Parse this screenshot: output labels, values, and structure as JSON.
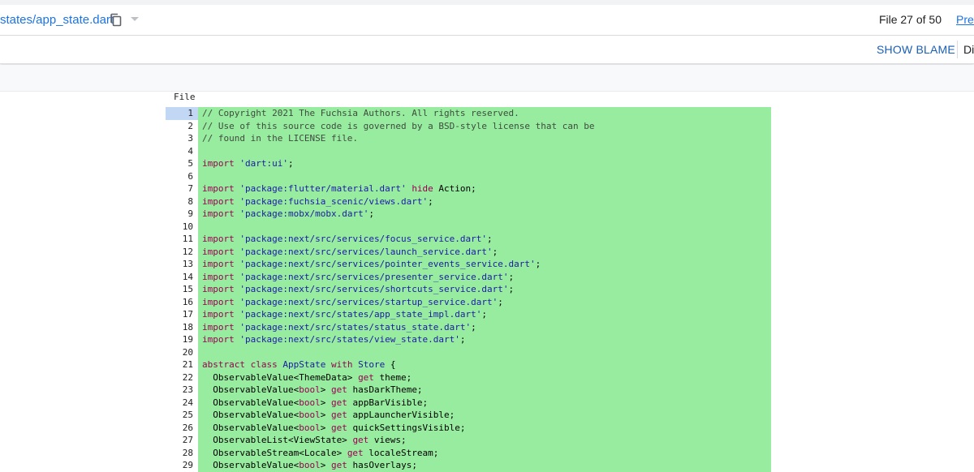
{
  "header": {
    "file_path": "states/app_state.dart",
    "file_count": "File 27 of 50",
    "prev_label": "Prev"
  },
  "toolbar": {
    "blame_label": "SHOW BLAME",
    "diff_label": "Di"
  },
  "file_view": {
    "label": "File",
    "selected_line": 1,
    "highlight_color": "#98ec9f",
    "lines": [
      {
        "n": "1",
        "tokens": [
          [
            "c",
            "// Copyright 2021 The Fuchsia Authors. All rights reserved."
          ]
        ]
      },
      {
        "n": "2",
        "tokens": [
          [
            "c",
            "// Use of this source code is governed by a BSD-style license that can be"
          ]
        ]
      },
      {
        "n": "3",
        "tokens": [
          [
            "c",
            "// found in the LICENSE file."
          ]
        ]
      },
      {
        "n": "4",
        "tokens": []
      },
      {
        "n": "5",
        "tokens": [
          [
            "k",
            "import"
          ],
          [
            "p",
            " "
          ],
          [
            "s",
            "'dart:ui'"
          ],
          [
            "p",
            ";"
          ]
        ]
      },
      {
        "n": "6",
        "tokens": []
      },
      {
        "n": "7",
        "tokens": [
          [
            "k",
            "import"
          ],
          [
            "p",
            " "
          ],
          [
            "s",
            "'package:flutter/material.dart'"
          ],
          [
            "p",
            " "
          ],
          [
            "k",
            "hide"
          ],
          [
            "p",
            " Action;"
          ]
        ]
      },
      {
        "n": "8",
        "tokens": [
          [
            "k",
            "import"
          ],
          [
            "p",
            " "
          ],
          [
            "s",
            "'package:fuchsia_scenic/views.dart'"
          ],
          [
            "p",
            ";"
          ]
        ]
      },
      {
        "n": "9",
        "tokens": [
          [
            "k",
            "import"
          ],
          [
            "p",
            " "
          ],
          [
            "s",
            "'package:mobx/mobx.dart'"
          ],
          [
            "p",
            ";"
          ]
        ]
      },
      {
        "n": "10",
        "tokens": []
      },
      {
        "n": "11",
        "tokens": [
          [
            "k",
            "import"
          ],
          [
            "p",
            " "
          ],
          [
            "s",
            "'package:next/src/services/focus_service.dart'"
          ],
          [
            "p",
            ";"
          ]
        ]
      },
      {
        "n": "12",
        "tokens": [
          [
            "k",
            "import"
          ],
          [
            "p",
            " "
          ],
          [
            "s",
            "'package:next/src/services/launch_service.dart'"
          ],
          [
            "p",
            ";"
          ]
        ]
      },
      {
        "n": "13",
        "tokens": [
          [
            "k",
            "import"
          ],
          [
            "p",
            " "
          ],
          [
            "s",
            "'package:next/src/services/pointer_events_service.dart'"
          ],
          [
            "p",
            ";"
          ]
        ]
      },
      {
        "n": "14",
        "tokens": [
          [
            "k",
            "import"
          ],
          [
            "p",
            " "
          ],
          [
            "s",
            "'package:next/src/services/presenter_service.dart'"
          ],
          [
            "p",
            ";"
          ]
        ]
      },
      {
        "n": "15",
        "tokens": [
          [
            "k",
            "import"
          ],
          [
            "p",
            " "
          ],
          [
            "s",
            "'package:next/src/services/shortcuts_service.dart'"
          ],
          [
            "p",
            ";"
          ]
        ]
      },
      {
        "n": "16",
        "tokens": [
          [
            "k",
            "import"
          ],
          [
            "p",
            " "
          ],
          [
            "s",
            "'package:next/src/services/startup_service.dart'"
          ],
          [
            "p",
            ";"
          ]
        ]
      },
      {
        "n": "17",
        "tokens": [
          [
            "k",
            "import"
          ],
          [
            "p",
            " "
          ],
          [
            "s",
            "'package:next/src/states/app_state_impl.dart'"
          ],
          [
            "p",
            ";"
          ]
        ]
      },
      {
        "n": "18",
        "tokens": [
          [
            "k",
            "import"
          ],
          [
            "p",
            " "
          ],
          [
            "s",
            "'package:next/src/states/status_state.dart'"
          ],
          [
            "p",
            ";"
          ]
        ]
      },
      {
        "n": "19",
        "tokens": [
          [
            "k",
            "import"
          ],
          [
            "p",
            " "
          ],
          [
            "s",
            "'package:next/src/states/view_state.dart'"
          ],
          [
            "p",
            ";"
          ]
        ]
      },
      {
        "n": "20",
        "tokens": []
      },
      {
        "n": "21",
        "tokens": [
          [
            "k",
            "abstract"
          ],
          [
            "p",
            " "
          ],
          [
            "k",
            "class"
          ],
          [
            "p",
            " "
          ],
          [
            "d",
            "AppState"
          ],
          [
            "p",
            " "
          ],
          [
            "k",
            "with"
          ],
          [
            "p",
            " "
          ],
          [
            "d",
            "Store"
          ],
          [
            "p",
            " {"
          ]
        ]
      },
      {
        "n": "22",
        "tokens": [
          [
            "p",
            "  ObservableValue<ThemeData> "
          ],
          [
            "k",
            "get"
          ],
          [
            "p",
            " theme;"
          ]
        ]
      },
      {
        "n": "23",
        "tokens": [
          [
            "p",
            "  ObservableValue<"
          ],
          [
            "t",
            "bool"
          ],
          [
            "p",
            "> "
          ],
          [
            "k",
            "get"
          ],
          [
            "p",
            " hasDarkTheme;"
          ]
        ]
      },
      {
        "n": "24",
        "tokens": [
          [
            "p",
            "  ObservableValue<"
          ],
          [
            "t",
            "bool"
          ],
          [
            "p",
            "> "
          ],
          [
            "k",
            "get"
          ],
          [
            "p",
            " appBarVisible;"
          ]
        ]
      },
      {
        "n": "25",
        "tokens": [
          [
            "p",
            "  ObservableValue<"
          ],
          [
            "t",
            "bool"
          ],
          [
            "p",
            "> "
          ],
          [
            "k",
            "get"
          ],
          [
            "p",
            " appLauncherVisible;"
          ]
        ]
      },
      {
        "n": "26",
        "tokens": [
          [
            "p",
            "  ObservableValue<"
          ],
          [
            "t",
            "bool"
          ],
          [
            "p",
            "> "
          ],
          [
            "k",
            "get"
          ],
          [
            "p",
            " quickSettingsVisible;"
          ]
        ]
      },
      {
        "n": "27",
        "tokens": [
          [
            "p",
            "  ObservableList<ViewState> "
          ],
          [
            "k",
            "get"
          ],
          [
            "p",
            " views;"
          ]
        ]
      },
      {
        "n": "28",
        "tokens": [
          [
            "p",
            "  ObservableStream<Locale> "
          ],
          [
            "k",
            "get"
          ],
          [
            "p",
            " localeStream;"
          ]
        ]
      },
      {
        "n": "29",
        "tokens": [
          [
            "p",
            "  ObservableValue<"
          ],
          [
            "t",
            "bool"
          ],
          [
            "p",
            "> "
          ],
          [
            "k",
            "get"
          ],
          [
            "p",
            " hasOverlays;"
          ]
        ]
      }
    ]
  }
}
